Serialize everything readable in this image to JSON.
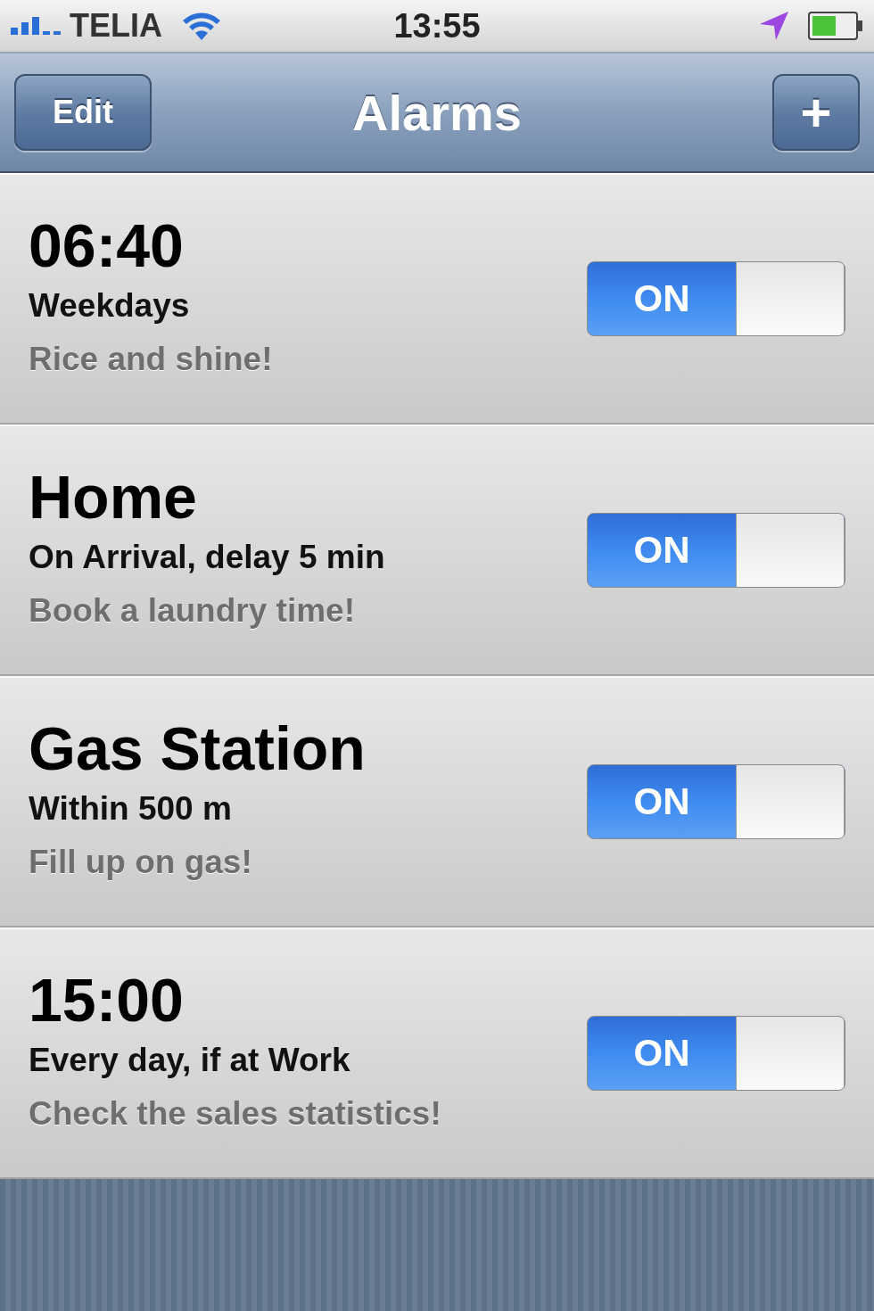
{
  "status_bar": {
    "carrier": "TELIA",
    "time": "13:55"
  },
  "nav_bar": {
    "left_button": "Edit",
    "title": "Alarms",
    "right_button": "+"
  },
  "alarms": [
    {
      "title": "06:40",
      "subtitle": "Weekdays",
      "note": "Rice and shine!",
      "toggle": {
        "label": "ON",
        "on": true
      }
    },
    {
      "title": "Home",
      "subtitle": "On Arrival, delay 5 min",
      "note": "Book a laundry time!",
      "toggle": {
        "label": "ON",
        "on": true
      }
    },
    {
      "title": "Gas Station",
      "subtitle": "Within 500 m",
      "note": "Fill up on gas!",
      "toggle": {
        "label": "ON",
        "on": true
      }
    },
    {
      "title": "15:00",
      "subtitle": "Every day, if at Work",
      "note": "Check the sales statistics!",
      "toggle": {
        "label": "ON",
        "on": true
      }
    }
  ]
}
